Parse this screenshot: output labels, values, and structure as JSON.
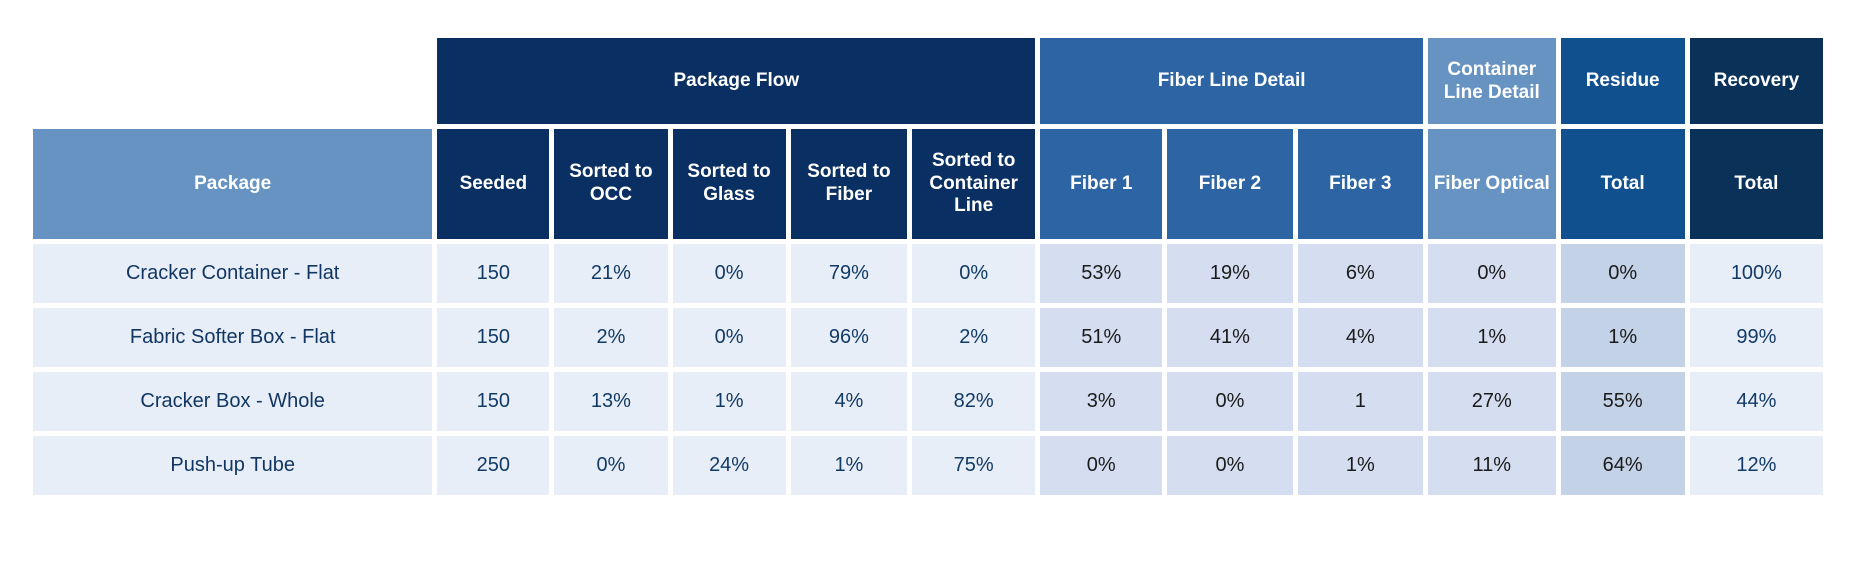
{
  "table": {
    "group_headers": [
      {
        "label": "",
        "span": 1,
        "tone": "blank"
      },
      {
        "label": "Package Flow",
        "span": 5,
        "tone": "navy"
      },
      {
        "label": "Fiber Line Detail",
        "span": 3,
        "tone": "mid"
      },
      {
        "label": "Container Line Detail",
        "span": 1,
        "tone": "steel"
      },
      {
        "label": "Residue",
        "span": 1,
        "tone": "residue"
      },
      {
        "label": "Recovery",
        "span": 1,
        "tone": "recovery"
      }
    ],
    "columns": [
      {
        "label": "Package",
        "tone": "steel",
        "align": "left"
      },
      {
        "label": "Seeded",
        "tone": "navy",
        "align": "center"
      },
      {
        "label": "Sorted to OCC",
        "tone": "navy",
        "align": "center"
      },
      {
        "label": "Sorted to Glass",
        "tone": "navy",
        "align": "center"
      },
      {
        "label": "Sorted to Fiber",
        "tone": "navy",
        "align": "center"
      },
      {
        "label": "Sorted to Container Line",
        "tone": "navy",
        "align": "center"
      },
      {
        "label": "Fiber 1",
        "tone": "mid",
        "align": "center"
      },
      {
        "label": "Fiber 2",
        "tone": "mid",
        "align": "center"
      },
      {
        "label": "Fiber 3",
        "tone": "mid",
        "align": "center"
      },
      {
        "label": "Fiber Optical",
        "tone": "steel",
        "align": "center"
      },
      {
        "label": "Total",
        "tone": "residue",
        "align": "center"
      },
      {
        "label": "Total",
        "tone": "recovery",
        "align": "center"
      }
    ],
    "cell_tones": [
      "light",
      "light",
      "light",
      "light",
      "light",
      "light",
      "mid",
      "mid",
      "mid",
      "mid",
      "dark",
      "light"
    ],
    "rows": [
      {
        "package": "Cracker Container - Flat",
        "values": [
          "150",
          "21%",
          "0%",
          "79%",
          "0%",
          "53%",
          "19%",
          "6%",
          "0%",
          "0%",
          "100%"
        ]
      },
      {
        "package": "Fabric Softer Box - Flat",
        "values": [
          "150",
          "2%",
          "0%",
          "96%",
          "2%",
          "51%",
          "41%",
          "4%",
          "1%",
          "1%",
          "99%"
        ]
      },
      {
        "package": "Cracker Box - Whole",
        "values": [
          "150",
          "13%",
          "1%",
          "4%",
          "82%",
          "3%",
          "0%",
          "1",
          "27%",
          "55%",
          "44%"
        ]
      },
      {
        "package": "Push-up Tube",
        "values": [
          "250",
          "0%",
          "24%",
          "1%",
          "75%",
          "0%",
          "0%",
          "1%",
          "11%",
          "64%",
          "12%"
        ]
      }
    ]
  },
  "colors": {
    "navy": "#0a2f62",
    "mid_blue": "#2d64a3",
    "steel_blue": "#6693c2",
    "residue_blue": "#11508f",
    "recovery_navy": "#0a3258",
    "cell_light": "#e8eef7",
    "cell_mid": "#d5def0",
    "cell_dark": "#c3d2e6",
    "label_text": "#113663"
  },
  "chart_data": {
    "type": "table",
    "title": "",
    "categories": [
      "Cracker Container - Flat",
      "Fabric Softer Box - Flat",
      "Cracker Box - Whole",
      "Push-up Tube"
    ],
    "column_headers": [
      "Package",
      "Seeded",
      "Sorted to OCC",
      "Sorted to Glass",
      "Sorted to Fiber",
      "Sorted to Container Line",
      "Fiber 1",
      "Fiber 2",
      "Fiber 3",
      "Fiber Optical",
      "Residue Total",
      "Recovery Total"
    ],
    "group_headers": [
      "Package Flow",
      "Fiber Line Detail",
      "Container Line Detail",
      "Residue",
      "Recovery"
    ],
    "series": [
      {
        "name": "Seeded",
        "values": [
          150,
          150,
          150,
          250
        ]
      },
      {
        "name": "Sorted to OCC",
        "values": [
          21,
          2,
          13,
          0
        ]
      },
      {
        "name": "Sorted to Glass",
        "values": [
          0,
          0,
          1,
          24
        ]
      },
      {
        "name": "Sorted to Fiber",
        "values": [
          79,
          96,
          4,
          1
        ]
      },
      {
        "name": "Sorted to Container Line",
        "values": [
          0,
          2,
          82,
          75
        ]
      },
      {
        "name": "Fiber 1",
        "values": [
          53,
          51,
          3,
          0
        ]
      },
      {
        "name": "Fiber 2",
        "values": [
          19,
          41,
          0,
          0
        ]
      },
      {
        "name": "Fiber 3",
        "values": [
          6,
          4,
          1,
          1
        ]
      },
      {
        "name": "Fiber Optical",
        "values": [
          0,
          1,
          27,
          11
        ]
      },
      {
        "name": "Residue Total",
        "values": [
          0,
          1,
          55,
          64
        ]
      },
      {
        "name": "Recovery Total",
        "values": [
          100,
          99,
          44,
          12
        ]
      }
    ]
  }
}
